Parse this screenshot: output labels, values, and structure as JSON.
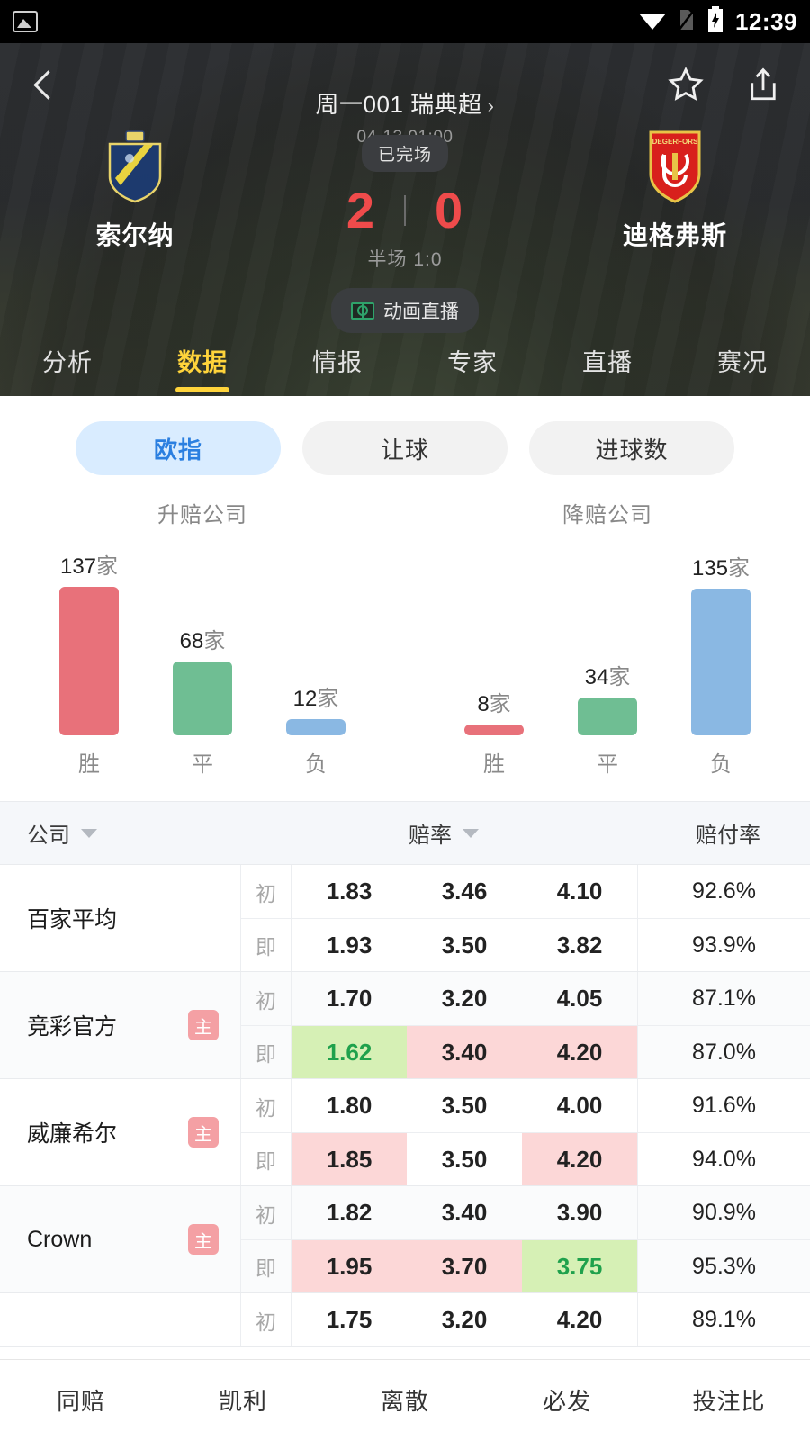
{
  "status_bar": {
    "time": "12:39",
    "icons": [
      "photo-icon",
      "wifi-icon",
      "sim-off-icon",
      "battery-charging-icon"
    ]
  },
  "header": {
    "back_icon": "chevron-left-icon",
    "title": "周一001 瑞典超",
    "title_chevron": "›",
    "datetime": "04-13 01:00",
    "favorite_icon": "star-icon",
    "share_icon": "share-icon"
  },
  "match": {
    "home_team": "索尔纳",
    "away_team": "迪格弗斯",
    "status": "已完场",
    "home_score": "2",
    "away_score": "0",
    "halftime": "半场 1:0",
    "live_button": "动画直播",
    "live_icon": "pitch-icon"
  },
  "tabs": [
    {
      "label": "分析",
      "active": false
    },
    {
      "label": "数据",
      "active": true
    },
    {
      "label": "情报",
      "active": false
    },
    {
      "label": "专家",
      "active": false
    },
    {
      "label": "直播",
      "active": false
    },
    {
      "label": "赛况",
      "active": false
    }
  ],
  "segments": [
    {
      "label": "欧指",
      "selected": true
    },
    {
      "label": "让球",
      "selected": false
    },
    {
      "label": "进球数",
      "selected": false
    }
  ],
  "chart_data": [
    {
      "type": "bar",
      "title": "升赔公司",
      "categories": [
        "胜",
        "平",
        "负"
      ],
      "values": [
        137,
        68,
        12
      ],
      "labels": [
        "137家",
        "68家",
        "12家"
      ],
      "colors": [
        "#E8717A",
        "#6FBE93",
        "#8AB8E3"
      ],
      "unit": "家",
      "xlabel": "",
      "ylabel": "",
      "ylim": [
        0,
        150
      ]
    },
    {
      "type": "bar",
      "title": "降赔公司",
      "categories": [
        "胜",
        "平",
        "负"
      ],
      "values": [
        8,
        34,
        135
      ],
      "labels": [
        "8家",
        "34家",
        "135家"
      ],
      "colors": [
        "#E8717A",
        "#6FBE93",
        "#8AB8E3"
      ],
      "unit": "家",
      "xlabel": "",
      "ylabel": "",
      "ylim": [
        0,
        150
      ]
    }
  ],
  "table": {
    "headers": {
      "company": "公司",
      "odds": "赔率",
      "payout": "赔付率"
    },
    "sort_icon": "caret-down-icon",
    "rows": [
      {
        "company": "百家平均",
        "home_badge": "",
        "lines": [
          {
            "tag": "初",
            "o1": "1.83",
            "o2": "3.46",
            "o3": "4.10",
            "payout": "92.6%",
            "h1": "",
            "h2": "",
            "h3": ""
          },
          {
            "tag": "即",
            "o1": "1.93",
            "o2": "3.50",
            "o3": "3.82",
            "payout": "93.9%",
            "h1": "",
            "h2": "",
            "h3": ""
          }
        ]
      },
      {
        "company": "竞彩官方",
        "home_badge": "主",
        "lines": [
          {
            "tag": "初",
            "o1": "1.70",
            "o2": "3.20",
            "o3": "4.05",
            "payout": "87.1%",
            "h1": "",
            "h2": "",
            "h3": ""
          },
          {
            "tag": "即",
            "o1": "1.62",
            "o2": "3.40",
            "o3": "4.20",
            "payout": "87.0%",
            "h1": "down",
            "h2": "up",
            "h3": "up"
          }
        ]
      },
      {
        "company": "威廉希尔",
        "home_badge": "主",
        "lines": [
          {
            "tag": "初",
            "o1": "1.80",
            "o2": "3.50",
            "o3": "4.00",
            "payout": "91.6%",
            "h1": "",
            "h2": "",
            "h3": ""
          },
          {
            "tag": "即",
            "o1": "1.85",
            "o2": "3.50",
            "o3": "4.20",
            "payout": "94.0%",
            "h1": "up",
            "h2": "",
            "h3": "up"
          }
        ]
      },
      {
        "company": "Crown",
        "home_badge": "主",
        "lines": [
          {
            "tag": "初",
            "o1": "1.82",
            "o2": "3.40",
            "o3": "3.90",
            "payout": "90.9%",
            "h1": "",
            "h2": "",
            "h3": ""
          },
          {
            "tag": "即",
            "o1": "1.95",
            "o2": "3.70",
            "o3": "3.75",
            "payout": "95.3%",
            "h1": "up",
            "h2": "up",
            "h3": "down"
          }
        ]
      },
      {
        "company": "",
        "home_badge": "",
        "lines": [
          {
            "tag": "初",
            "o1": "1.75",
            "o2": "3.20",
            "o3": "4.20",
            "payout": "89.1%",
            "h1": "",
            "h2": "",
            "h3": ""
          }
        ]
      }
    ]
  },
  "bottom_nav": [
    {
      "label": "同赔"
    },
    {
      "label": "凯利"
    },
    {
      "label": "离散"
    },
    {
      "label": "必发"
    },
    {
      "label": "投注比"
    }
  ],
  "colors": {
    "accent_yellow": "#ffd43b",
    "score_red": "#ef4b4b",
    "seg_active_bg": "#d9ecff",
    "seg_active_text": "#2b7fe0",
    "bar_red": "#E8717A",
    "bar_green": "#6FBE93",
    "bar_blue": "#8AB8E3",
    "odds_up_bg": "#fcd7d7",
    "odds_down_bg": "#d6f0b5",
    "odds_down_text": "#1fa14c",
    "badge_home_bg": "#f4a0a4"
  }
}
